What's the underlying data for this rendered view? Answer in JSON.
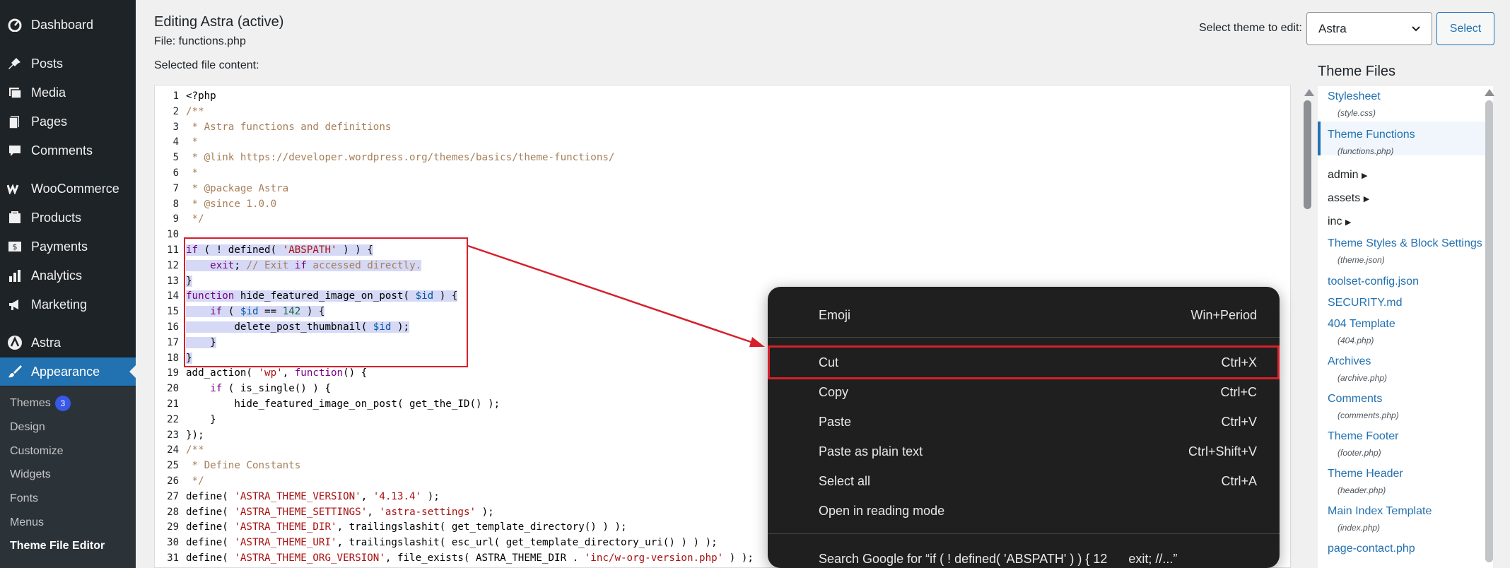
{
  "sidebar": {
    "items": [
      {
        "label": "Dashboard",
        "icon": "dashboard-icon"
      },
      {
        "label": "Posts",
        "icon": "pin-icon"
      },
      {
        "label": "Media",
        "icon": "media-icon"
      },
      {
        "label": "Pages",
        "icon": "pages-icon"
      },
      {
        "label": "Comments",
        "icon": "comment-icon"
      },
      {
        "label": "WooCommerce",
        "icon": "woocommerce-icon"
      },
      {
        "label": "Products",
        "icon": "products-icon"
      },
      {
        "label": "Payments",
        "icon": "payments-icon"
      },
      {
        "label": "Analytics",
        "icon": "analytics-icon"
      },
      {
        "label": "Marketing",
        "icon": "megaphone-icon"
      },
      {
        "label": "Astra",
        "icon": "astra-icon"
      },
      {
        "label": "Appearance",
        "icon": "brush-icon"
      }
    ],
    "submenu": [
      {
        "label": "Themes",
        "badge": "3"
      },
      {
        "label": "Design"
      },
      {
        "label": "Customize"
      },
      {
        "label": "Widgets"
      },
      {
        "label": "Fonts"
      },
      {
        "label": "Menus"
      },
      {
        "label": "Theme File Editor"
      }
    ]
  },
  "header": {
    "title": "Editing Astra (active)",
    "file": "File: functions.php",
    "selected_content": "Selected file content:",
    "select_theme_label": "Select theme to edit:",
    "theme_value": "Astra",
    "select_button": "Select"
  },
  "editor": {
    "line_numbers": [
      "1",
      "2",
      "3",
      "4",
      "5",
      "6",
      "7",
      "8",
      "9",
      "10",
      "11",
      "12",
      "13",
      "14",
      "15",
      "16",
      "17",
      "18",
      "19",
      "20",
      "21",
      "22",
      "23",
      "24",
      "25",
      "26",
      "27",
      "28",
      "29",
      "30",
      "31"
    ],
    "lines": [
      "<?php",
      "/**",
      " * Astra functions and definitions",
      " *",
      " * @link https://developer.wordpress.org/themes/basics/theme-functions/",
      " *",
      " * @package Astra",
      " * @since 1.0.0",
      " */",
      "",
      "if ( ! defined( 'ABSPATH' ) ) {",
      "    exit; // Exit if accessed directly.",
      "}",
      "function hide_featured_image_on_post( $id ) {",
      "    if ( $id == 142 ) {",
      "        delete_post_thumbnail( $id );",
      "    }",
      "}",
      "add_action( 'wp', function() {",
      "    if ( is_single() ) {",
      "        hide_featured_image_on_post( get_the_ID() );",
      "    }",
      "});",
      "/**",
      " * Define Constants",
      " */",
      "define( 'ASTRA_THEME_VERSION', '4.13.4' );",
      "define( 'ASTRA_THEME_SETTINGS', 'astra-settings' );",
      "define( 'ASTRA_THEME_DIR', trailingslashit( get_template_directory() ) );",
      "define( 'ASTRA_THEME_URI', trailingslashit( esc_url( get_template_directory_uri() ) ) );",
      "define( 'ASTRA_THEME_ORG_VERSION', file_exists( ASTRA_THEME_DIR . 'inc/w-org-version.php' ) );"
    ]
  },
  "theme_files": {
    "title": "Theme Files",
    "items": [
      {
        "label": "Stylesheet",
        "sub": "(style.css)"
      },
      {
        "label": "Theme Functions",
        "sub": "(functions.php)"
      },
      {
        "label": "admin",
        "dir": true
      },
      {
        "label": "assets",
        "dir": true
      },
      {
        "label": "inc",
        "dir": true
      },
      {
        "label": "Theme Styles & Block Settings",
        "sub": "(theme.json)"
      },
      {
        "label": "toolset-config.json"
      },
      {
        "label": "SECURITY.md"
      },
      {
        "label": "404 Template",
        "sub": "(404.php)"
      },
      {
        "label": "Archives",
        "sub": "(archive.php)"
      },
      {
        "label": "Comments",
        "sub": "(comments.php)"
      },
      {
        "label": "Theme Footer",
        "sub": "(footer.php)"
      },
      {
        "label": "Theme Header",
        "sub": "(header.php)"
      },
      {
        "label": "Main Index Template",
        "sub": "(index.php)"
      },
      {
        "label": "page-contact.php"
      }
    ]
  },
  "context_menu": {
    "items": [
      {
        "label": "Emoji",
        "key": "Win+Period"
      },
      {
        "label": "Cut",
        "key": "Ctrl+X"
      },
      {
        "label": "Copy",
        "key": "Ctrl+C"
      },
      {
        "label": "Paste",
        "key": "Ctrl+V"
      },
      {
        "label": "Paste as plain text",
        "key": "Ctrl+Shift+V"
      },
      {
        "label": "Select all",
        "key": "Ctrl+A"
      },
      {
        "label": "Open in reading mode",
        "key": ""
      },
      {
        "label": "Search Google for “if ( ! defined( 'ABSPATH' ) ) { 12      exit; //...”",
        "key": ""
      }
    ]
  },
  "colors": {
    "sidebar_bg": "#1d2327",
    "accent": "#2271b1",
    "highlight_red": "#d6202b",
    "menu_bg": "#1f1f1f"
  }
}
